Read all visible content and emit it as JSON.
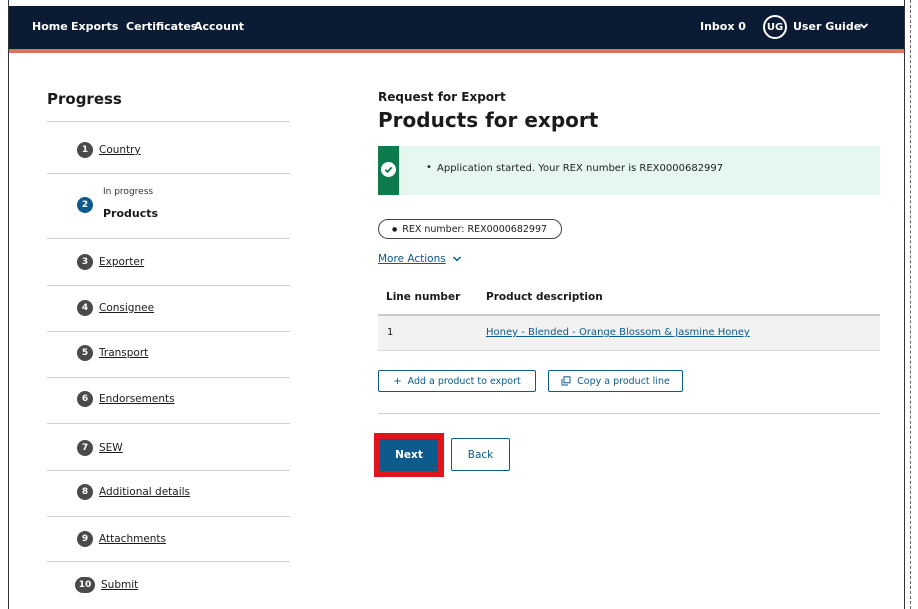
{
  "nav": {
    "links": [
      "Home",
      "Exports",
      "Certificates",
      "Account"
    ],
    "inbox_label": "Inbox 0",
    "avatar_initials": "UG",
    "user_name": "User Guide"
  },
  "progress": {
    "title": "Progress",
    "steps": [
      {
        "num": "1",
        "label": "Country"
      },
      {
        "num": "2",
        "status": "In progress",
        "label": "Products"
      },
      {
        "num": "3",
        "label": "Exporter"
      },
      {
        "num": "4",
        "label": "Consignee"
      },
      {
        "num": "5",
        "label": "Transport"
      },
      {
        "num": "6",
        "label": "Endorsements"
      },
      {
        "num": "7",
        "label": "SEW"
      },
      {
        "num": "8",
        "label": "Additional details"
      },
      {
        "num": "9",
        "label": "Attachments"
      },
      {
        "num": "10",
        "label": "Submit"
      }
    ]
  },
  "main": {
    "kicker": "Request for Export",
    "title": "Products for export",
    "alert_message": "Application started. Your REX number is REX0000682997",
    "rex_pill": "REX number: REX0000682997",
    "more_actions": "More Actions",
    "table": {
      "headers": [
        "Line number",
        "Product description"
      ],
      "rows": [
        {
          "line": "1",
          "description": "Honey - Blended - Orange Blossom & Jasmine Honey"
        }
      ]
    },
    "add_product_label": "Add a product to export",
    "copy_line_label": "Copy a product line",
    "next_label": "Next",
    "back_label": "Back"
  },
  "colors": {
    "nav_bg": "#0a1b33",
    "accent_stripe": "#e5705e",
    "primary": "#0d5a8c",
    "success": "#0e7a4d",
    "success_bg": "#e5f7ef",
    "highlight": "#e0151c"
  }
}
